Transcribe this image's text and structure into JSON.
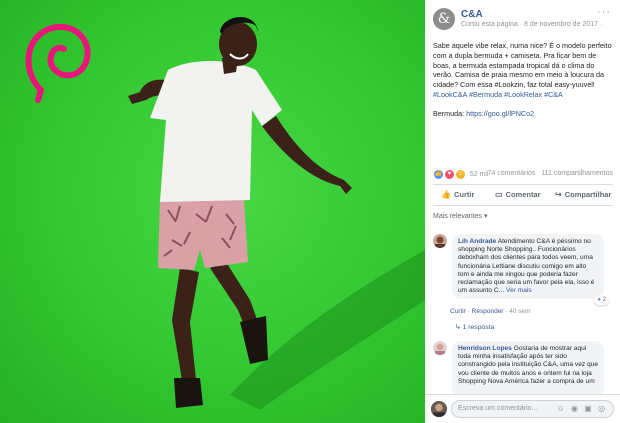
{
  "page": {
    "name": "C&A",
    "avatar_glyph": "&",
    "meta": "Curtiu esta página · 8 de novembro de 2017 ·",
    "more_glyph": "···"
  },
  "post": {
    "text": "Sabe aquele vibe relax, numa nice? É o modelo perfeito com a dupla bermuda + camiseta. Pra ficar bem de boas, a bermuda estampada tropical dá o clima do verão. Camisa de praia mesmo em meio à loucura da cidade? Com essa #Lookzin, faz total easy-yuuvel!",
    "tags": "#LookC&A #Bermuda #LookRelax #C&A",
    "link_prefix": "Bermuda: ",
    "link": "https://goo.gl/lPNCo2"
  },
  "reactions": {
    "count": "52 mil",
    "comments": "74 comentários",
    "shares": "111 compartilhamentos",
    "icons": [
      "like-icon",
      "love-icon",
      "haha-icon"
    ]
  },
  "actions": {
    "like": "Curtir",
    "comment": "Comentar",
    "share": "Compartilhar"
  },
  "relevance": "Mais relevantes ▾",
  "comments": [
    {
      "author": "Lih Andrade",
      "text": "Atendimento C&A é péssimo no shopping Norte Shopping.. Funcionários deboxham dos clientes para todos veem, uma funcionária Lettiane discutiu comigo em alto tom e ainda me xingou que poderia fazer reclamação que seria um favor pela ela, isso é um assunto C...",
      "see_more": "Ver mais",
      "reaction_count": "2",
      "actions": {
        "like": "Curtir",
        "reply": "Responder",
        "time": "40 sem"
      },
      "replies": "1 resposta"
    },
    {
      "author": "Henridson Lopes",
      "text": "Gostaria de mostrar aqui toda minha insatisfação após ter sido constrangido pela instituição C&A, uma vez que vou cliente de muitos anos e ontem fui na loja Shopping Nova América fazer a compra de um"
    }
  ],
  "write": {
    "placeholder": "Escreva um comentário...",
    "icons": "☺ ◉ ▣ ◎"
  }
}
